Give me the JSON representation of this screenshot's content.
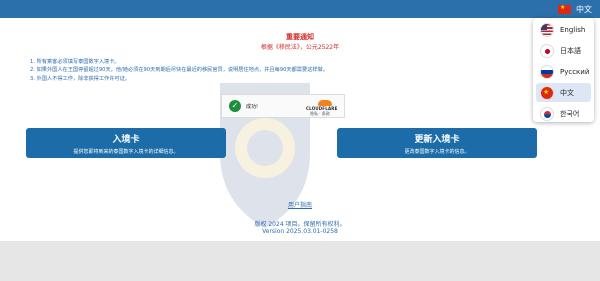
{
  "header": {
    "current_language": "中文"
  },
  "notice": {
    "title": "重要通知",
    "subtitle": "根据《移民法》，公元2522年",
    "rules": [
      "1. 所有乘客必须填写泰国数字入境卡。",
      "2. 如果外国人在王国停留超过90天，他/她必须在90天到期后尽快在最近的移民官员，说明居住地点，并且每90天都需要这样做。",
      "3. 外国人不得工作，除非获得工作许可证。"
    ]
  },
  "captcha": {
    "status": "成功!",
    "brand": "CLOUDFLARE",
    "links": "隐私 · 条款"
  },
  "actions": {
    "entry": {
      "title": "入境卡",
      "desc": "提供您即将到来的泰国数字入境卡的详细信息。"
    },
    "renew": {
      "title": "更新入境卡",
      "desc": "更改泰国数字入境卡的信息。"
    }
  },
  "footer": {
    "guide": "用户指南",
    "copyright": "版权 2024 项目。保留所有权利。",
    "version": "Version 2025.03.01-0258"
  },
  "language_menu": {
    "items": [
      {
        "code": "en",
        "label": "English",
        "flag_icon": "us-flag-icon"
      },
      {
        "code": "ja",
        "label": "日本語",
        "flag_icon": "jp-flag-icon"
      },
      {
        "code": "ru",
        "label": "Русский",
        "flag_icon": "ru-flag-icon"
      },
      {
        "code": "zh",
        "label": "中文",
        "flag_icon": "cn-flag-icon",
        "selected": true
      },
      {
        "code": "ko",
        "label": "한국어",
        "flag_icon": "kr-flag-icon"
      }
    ]
  },
  "colors": {
    "header_bg": "#2b70aa",
    "button_bg": "#1b6ca8",
    "notice_red": "#d42a2a",
    "link_blue": "#2b6cb0"
  }
}
